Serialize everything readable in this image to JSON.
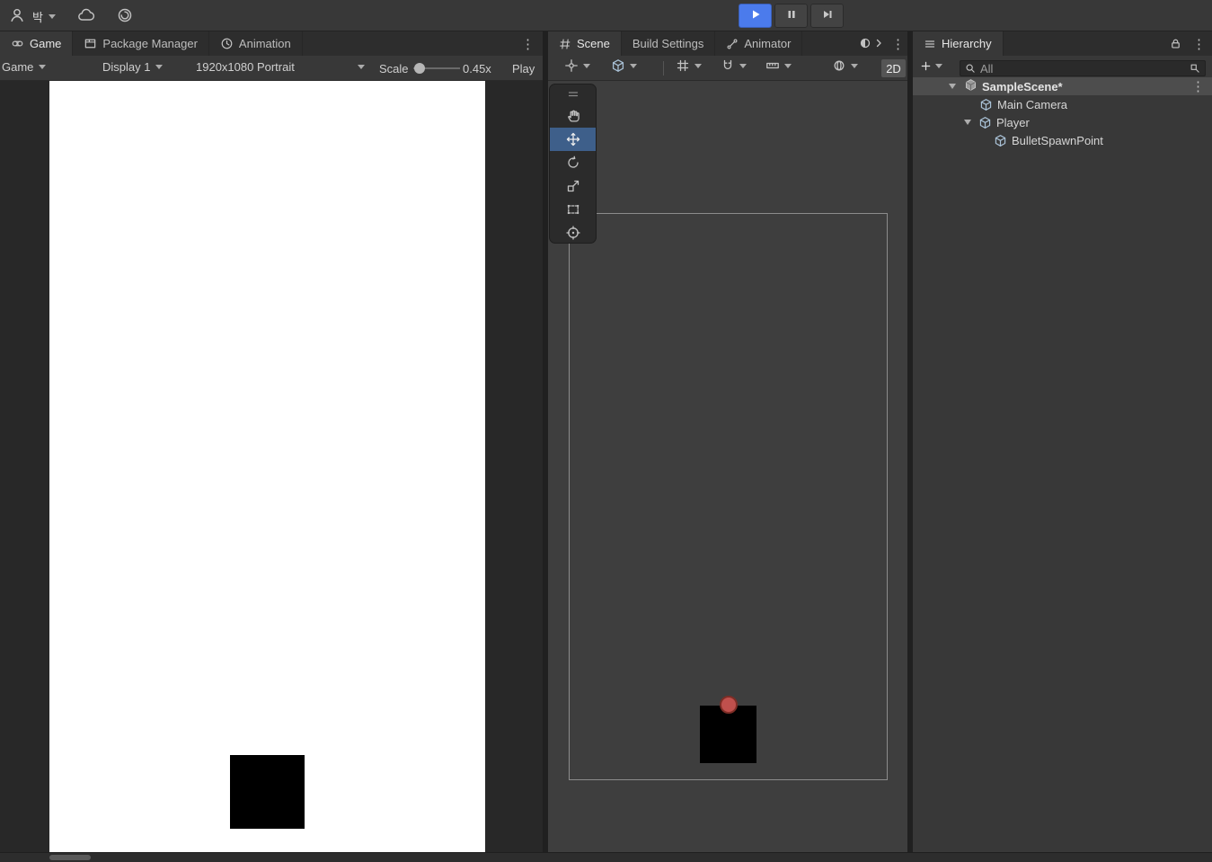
{
  "colors": {
    "play_button_active": "#4B7BEC",
    "tool_selected": "#3E5F8A",
    "hierarchy_row_selected": "#4D4D4D",
    "spawn_point_fill": "#C0504D",
    "spawn_point_stroke": "#7E2D26"
  },
  "topbar": {
    "account_label": "박"
  },
  "game_panel": {
    "tabs": [
      {
        "label": "Game"
      },
      {
        "label": "Package Manager"
      },
      {
        "label": "Animation"
      }
    ],
    "overflow_menu": "⋮",
    "toolbar": {
      "view_dropdown": "Game",
      "display_dropdown": "Display 1",
      "resolution_dropdown": "1920x1080 Portrait",
      "scale_label": "Scale",
      "scale_value": "0.45x",
      "play_focused_label": "Play"
    }
  },
  "scene_panel": {
    "tabs": [
      {
        "label": "Scene"
      },
      {
        "label": "Build Settings"
      },
      {
        "label": "Animator"
      }
    ],
    "overflow_menu": "⋮",
    "toolbar": {
      "mode_2d_label": "2D"
    }
  },
  "hierarchy_panel": {
    "tab_label": "Hierarchy",
    "overflow_menu": "⋮",
    "search_filter": "All",
    "items": [
      {
        "label": "SampleScene*"
      },
      {
        "label": "Main Camera"
      },
      {
        "label": "Player"
      },
      {
        "label": "BulletSpawnPoint"
      }
    ]
  }
}
